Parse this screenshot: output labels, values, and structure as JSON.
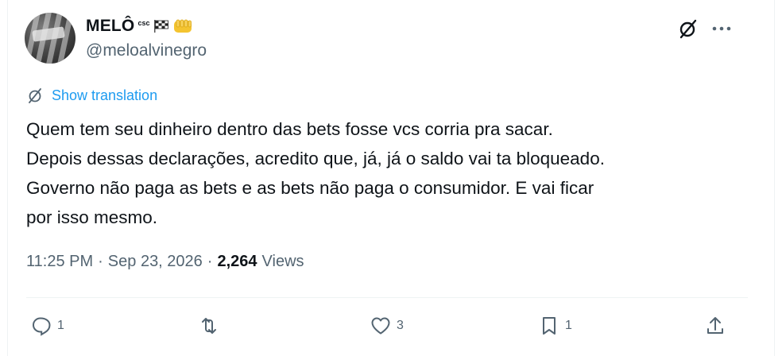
{
  "tweet": {
    "author": {
      "display_name": "MELÔ",
      "name_badge": "csc",
      "handle": "@meloalvinegro",
      "avatar_icon": "avatar-image"
    },
    "icons": {
      "grok": "grok-icon",
      "more": "more-horizontal-icon",
      "translate": "translate-icon",
      "flag": "checkered-flag-icon",
      "fist": "raised-fist-icon"
    },
    "translation_label": "Show translation",
    "body_lines": [
      "Quem tem seu dinheiro dentro das bets fosse vcs corria pra sacar.",
      "Depois dessas declarações, acredito que, já, já o saldo vai ta bloqueado.",
      "Governo não paga as bets e as bets não paga o consumidor. E vai ficar",
      "por isso mesmo."
    ],
    "time": "11:25 PM",
    "separator": "·",
    "date": "Sep 23, 2026",
    "views_count": "2,264",
    "views_label": "Views"
  },
  "actions": {
    "reply_count": "1",
    "retweet_count": "",
    "like_count": "3",
    "bookmark_count": "1"
  },
  "colors": {
    "accent": "#1d9bf0",
    "text": "#0f1419",
    "secondary": "#536471",
    "divider": "#eff3f4"
  }
}
